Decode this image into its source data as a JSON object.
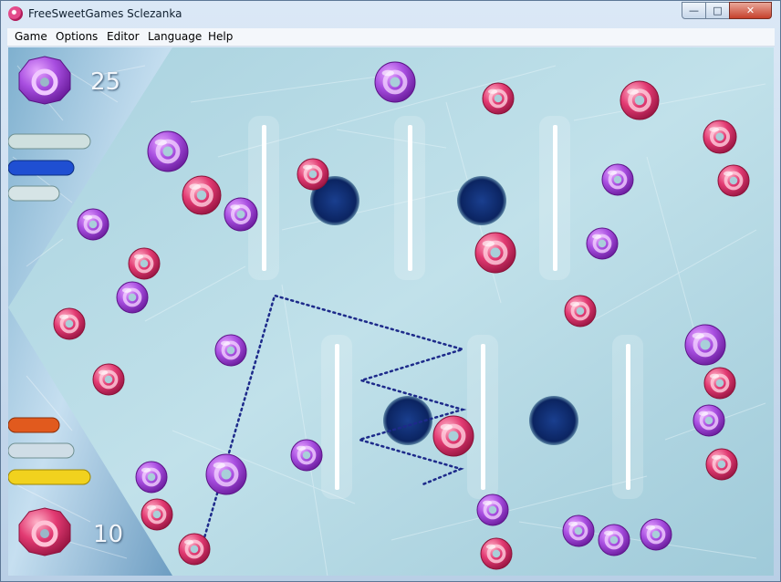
{
  "window": {
    "title": "FreeSweetGames Sclezanka",
    "min": "—",
    "max": "□",
    "close": "✕"
  },
  "menu": [
    "Game",
    "Options",
    "Editor",
    "Language",
    "Help"
  ],
  "players": {
    "top_score": "25",
    "bottom_score": "10"
  },
  "colors": {
    "purple": "#9b3bd6",
    "red": "#e0326d",
    "hole": "#0e2a6b",
    "ice": "#b7dbe7",
    "aim": "#1d2a8a"
  }
}
